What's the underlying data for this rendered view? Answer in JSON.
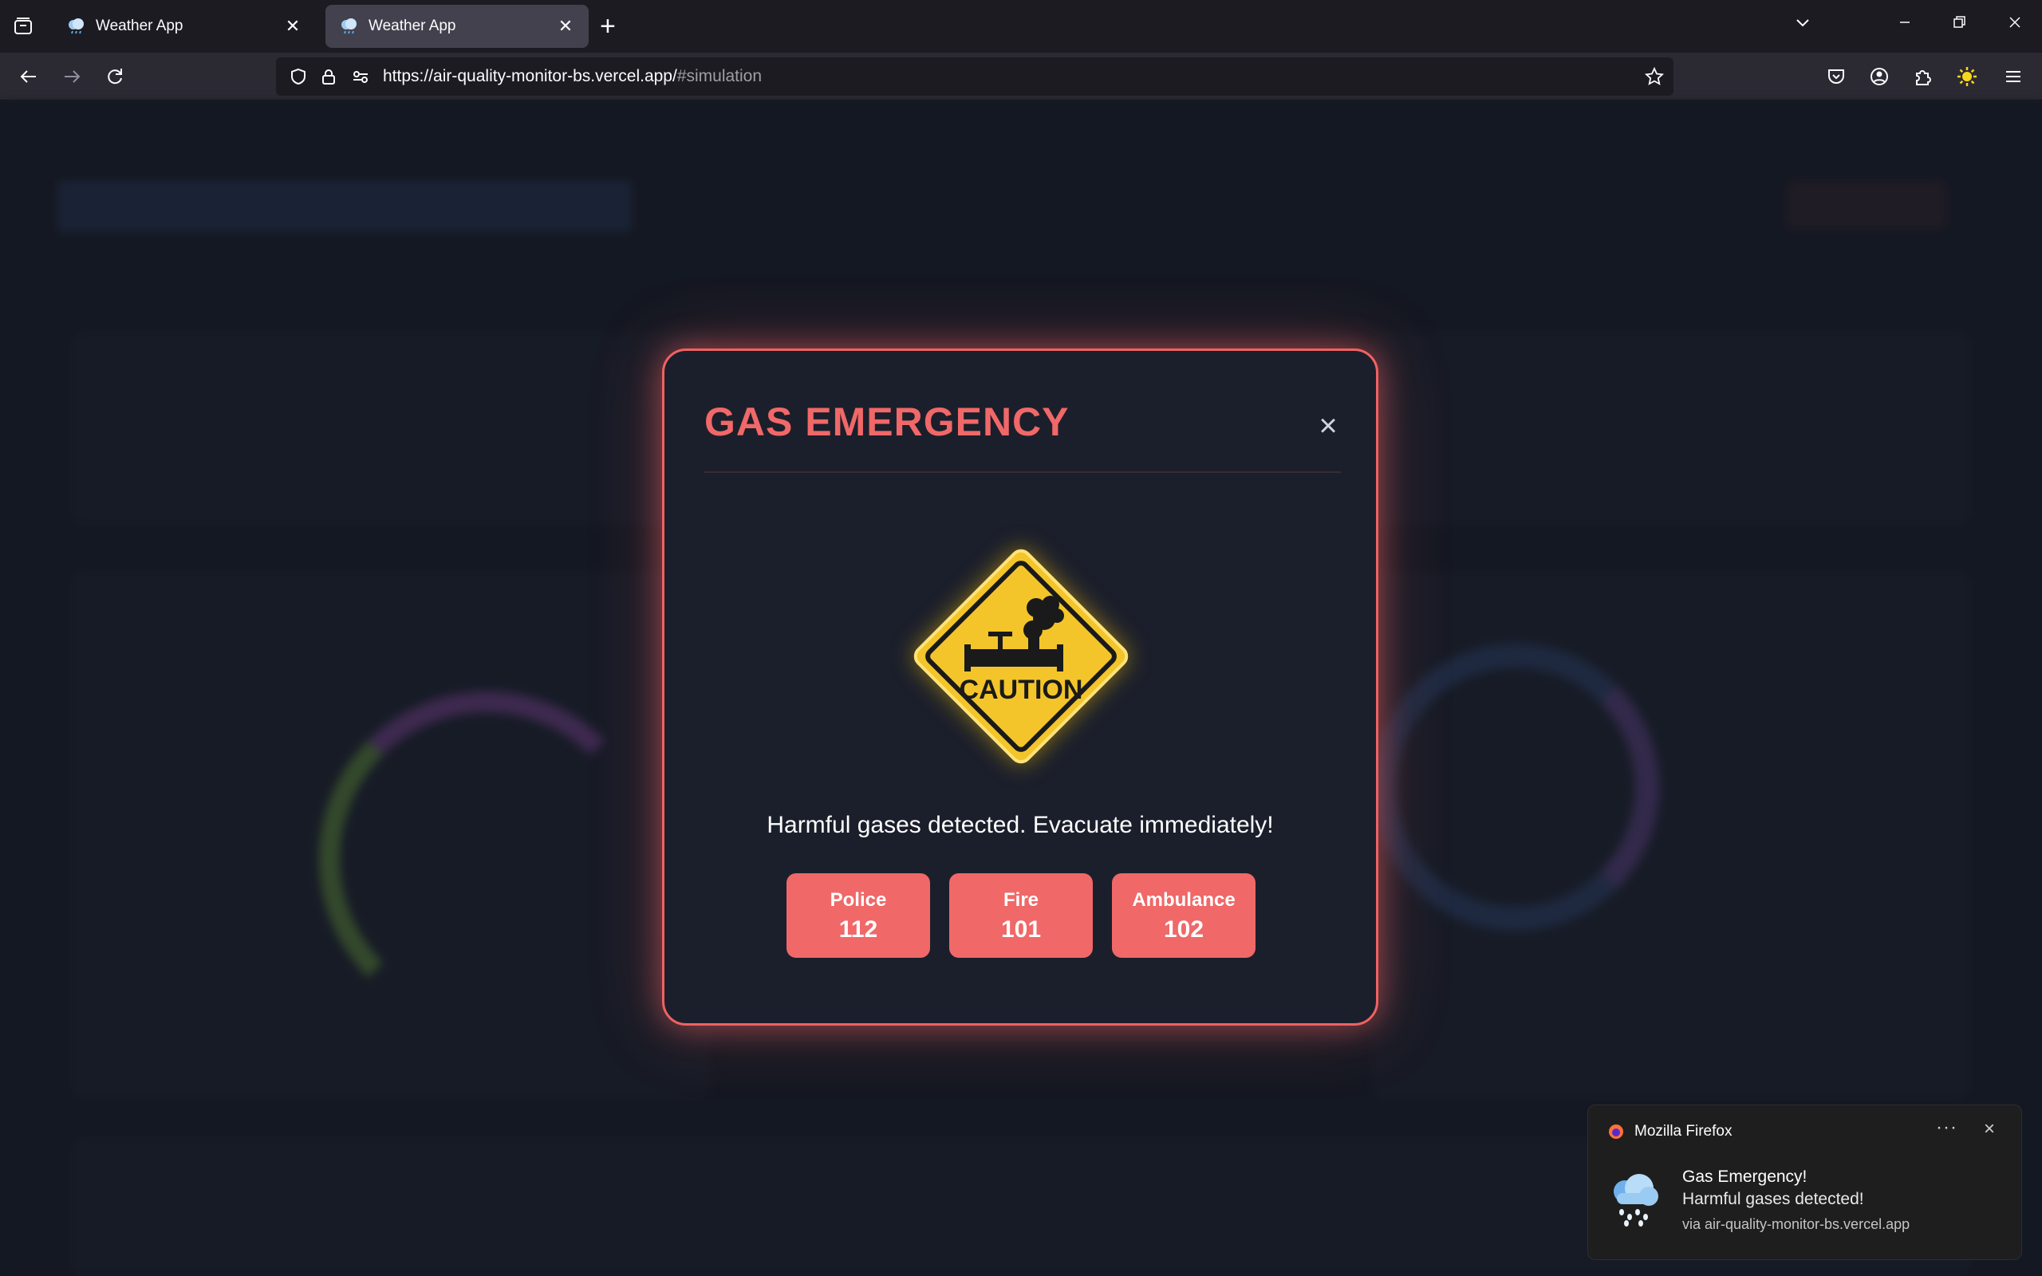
{
  "browser": {
    "tabs": [
      {
        "title": "Weather App",
        "active": false
      },
      {
        "title": "Weather App",
        "active": true
      }
    ],
    "url_host": "https://air-quality-monitor-bs.vercel.app/",
    "url_path": "#simulation",
    "icons": [
      "tab-list-icon",
      "back-icon",
      "forward-icon",
      "reload-icon",
      "shield-icon",
      "lock-icon",
      "permissions-icon",
      "bookmark-star-icon",
      "pocket-icon",
      "account-icon",
      "extensions-icon",
      "sun-icon",
      "menu-icon"
    ]
  },
  "modal": {
    "title": "GAS EMERGENCY",
    "close_glyph": "×",
    "sign_text": "CAUTION",
    "message": "Harmful gases detected. Evacuate immediately!",
    "contacts": [
      {
        "label": "Police",
        "number": "112"
      },
      {
        "label": "Fire",
        "number": "101"
      },
      {
        "label": "Ambulance",
        "number": "102"
      }
    ],
    "accent": "#f06868"
  },
  "notification": {
    "app": "Mozilla Firefox",
    "title": "Gas Emergency!",
    "body": "Harmful gases detected!",
    "via": "via air-quality-monitor-bs.vercel.app",
    "more_glyph": "···",
    "close_glyph": "×"
  }
}
